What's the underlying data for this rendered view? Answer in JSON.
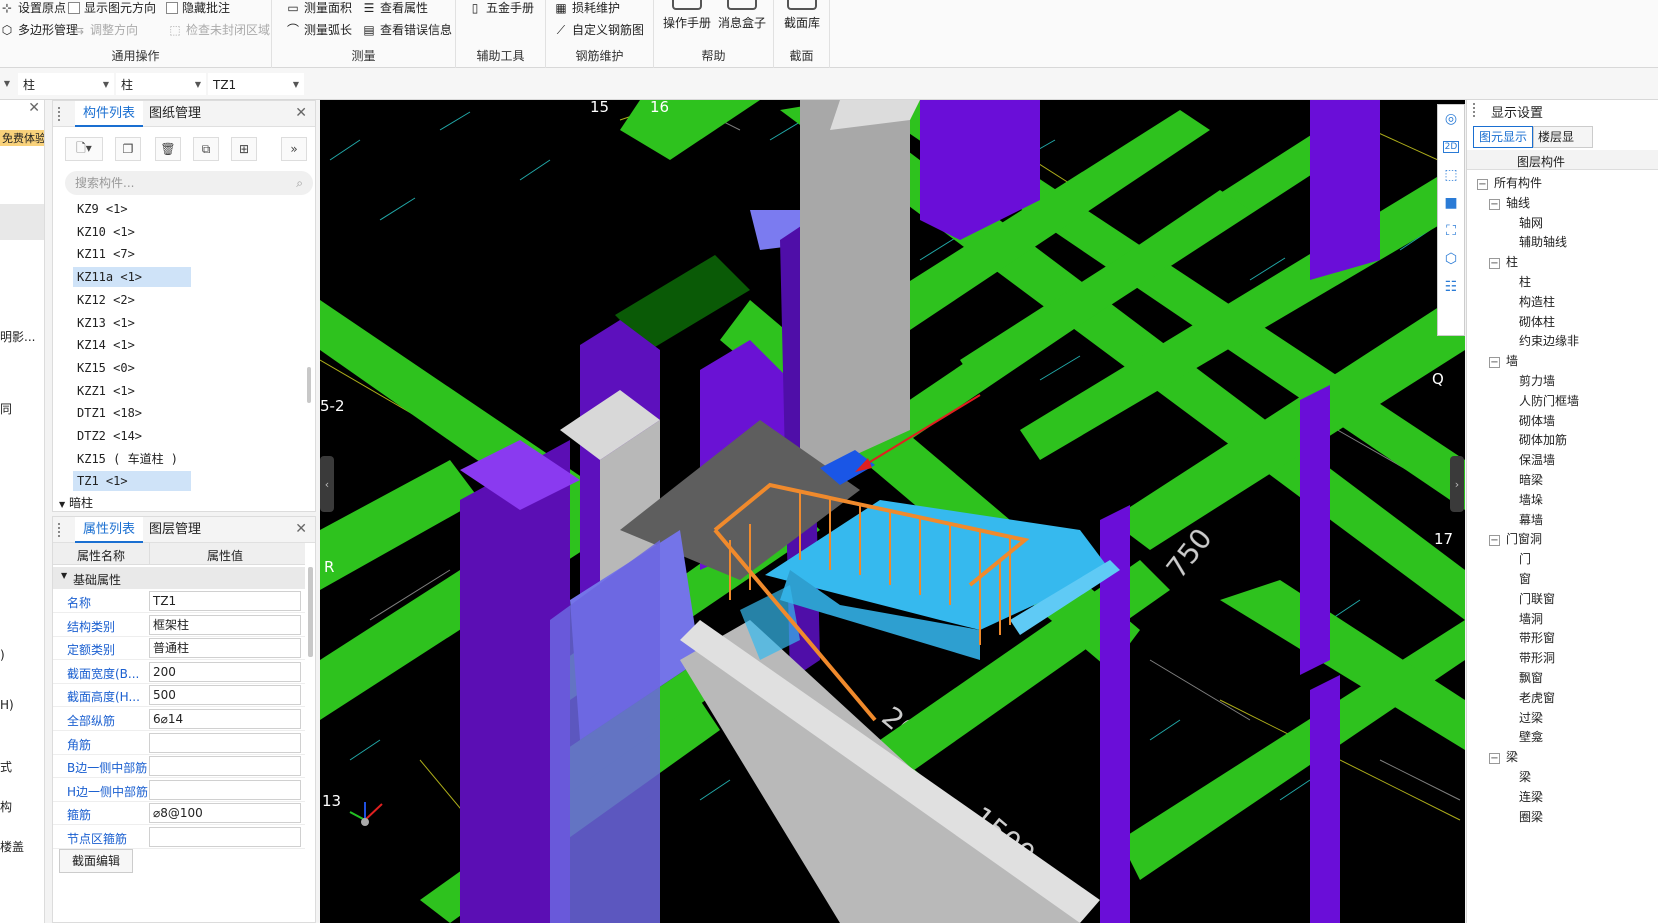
{
  "ribbon": {
    "groups": {
      "general": {
        "label": "通用操作",
        "items": [
          "设置原点",
          "显示图元方向",
          "隐藏批注",
          "多边形管理",
          "调整方向",
          "检查未封闭区域"
        ]
      },
      "measure": {
        "label": "测量",
        "items": [
          "测量面积",
          "查看属性",
          "测量弧长",
          "查看错误信息"
        ]
      },
      "aux": {
        "label": "辅助工具",
        "items": [
          "五金手册"
        ]
      },
      "rebar": {
        "label": "钢筋维护",
        "items": [
          "损耗维护",
          "自定义钢筋图"
        ]
      },
      "help": {
        "label": "帮助",
        "items": [
          "操作手册",
          "消息盒子"
        ]
      },
      "section": {
        "label": "截面",
        "items": [
          "截面库"
        ]
      }
    }
  },
  "selector": {
    "category": "柱",
    "type": "柱",
    "component": "TZ1"
  },
  "leftstrip": {
    "items": [
      "免费体验",
      "明影...",
      "同",
      ")",
      "H)",
      "式",
      "构",
      "楼盖"
    ]
  },
  "component_panel": {
    "tabs": [
      "构件列表",
      "图纸管理"
    ],
    "search_placeholder": "搜索构件...",
    "items": [
      {
        "label": "KZ9 <1>",
        "highlight": false
      },
      {
        "label": "KZ10 <1>",
        "highlight": false
      },
      {
        "label": "KZ11 <7>",
        "highlight": false
      },
      {
        "label": "KZ11a <1>",
        "highlight": true
      },
      {
        "label": "KZ12 <2>",
        "highlight": false
      },
      {
        "label": "KZ13 <1>",
        "highlight": false
      },
      {
        "label": "KZ14 <1>",
        "highlight": false
      },
      {
        "label": "KZ15 <0>",
        "highlight": false
      },
      {
        "label": "KZZ1 <1>",
        "highlight": false
      },
      {
        "label": "DTZ1 <18>",
        "highlight": false
      },
      {
        "label": "DTZ2 <14>",
        "highlight": false
      },
      {
        "label": "KZ15 ( 车道柱 ) <1>",
        "highlight": false
      },
      {
        "label": "TZ1 <1>",
        "highlight": true
      }
    ],
    "next_section": "暗柱"
  },
  "property_panel": {
    "tabs": [
      "属性列表",
      "图层管理"
    ],
    "col_name": "属性名称",
    "col_value": "属性值",
    "section": "基础属性",
    "rows": [
      {
        "name": "名称",
        "value": "TZ1"
      },
      {
        "name": "结构类别",
        "value": "框架柱"
      },
      {
        "name": "定额类别",
        "value": "普通柱"
      },
      {
        "name": "截面宽度(B...",
        "value": "200"
      },
      {
        "name": "截面高度(H...",
        "value": "500"
      },
      {
        "name": "全部纵筋",
        "value": "6⌀14"
      },
      {
        "name": "角筋",
        "value": ""
      },
      {
        "name": "B边一侧中部筋",
        "value": ""
      },
      {
        "name": "H边一侧中部筋",
        "value": ""
      },
      {
        "name": "箍筋",
        "value": "⌀8@100"
      },
      {
        "name": "节点区箍筋",
        "value": ""
      }
    ],
    "bottom_button": "截面编辑"
  },
  "viewport": {
    "labels": [
      "15",
      "16",
      "5-2",
      "R",
      "13",
      "Q",
      "17"
    ],
    "annotations": [
      "750",
      "200",
      "1500"
    ]
  },
  "display_panel": {
    "title": "显示设置",
    "tabs": [
      "图元显示",
      "楼层显"
    ],
    "header": "图层构件",
    "tree": [
      {
        "label": "所有构件",
        "level": 0,
        "group": true
      },
      {
        "label": "轴线",
        "level": 1,
        "group": true
      },
      {
        "label": "轴网",
        "level": 2,
        "group": false
      },
      {
        "label": "辅助轴线",
        "level": 2,
        "group": false
      },
      {
        "label": "柱",
        "level": 1,
        "group": true
      },
      {
        "label": "柱",
        "level": 2,
        "group": false
      },
      {
        "label": "构造柱",
        "level": 2,
        "group": false
      },
      {
        "label": "砌体柱",
        "level": 2,
        "group": false
      },
      {
        "label": "约束边缘非",
        "level": 2,
        "group": false
      },
      {
        "label": "墙",
        "level": 1,
        "group": true
      },
      {
        "label": "剪力墙",
        "level": 2,
        "group": false
      },
      {
        "label": "人防门框墙",
        "level": 2,
        "group": false
      },
      {
        "label": "砌体墙",
        "level": 2,
        "group": false
      },
      {
        "label": "砌体加筋",
        "level": 2,
        "group": false
      },
      {
        "label": "保温墙",
        "level": 2,
        "group": false
      },
      {
        "label": "暗梁",
        "level": 2,
        "group": false
      },
      {
        "label": "墙垛",
        "level": 2,
        "group": false
      },
      {
        "label": "幕墙",
        "level": 2,
        "group": false
      },
      {
        "label": "门窗洞",
        "level": 1,
        "group": true
      },
      {
        "label": "门",
        "level": 2,
        "group": false
      },
      {
        "label": "窗",
        "level": 2,
        "group": false
      },
      {
        "label": "门联窗",
        "level": 2,
        "group": false
      },
      {
        "label": "墙洞",
        "level": 2,
        "group": false
      },
      {
        "label": "带形窗",
        "level": 2,
        "group": false
      },
      {
        "label": "带形洞",
        "level": 2,
        "group": false
      },
      {
        "label": "飘窗",
        "level": 2,
        "group": false
      },
      {
        "label": "老虎窗",
        "level": 2,
        "group": false
      },
      {
        "label": "过梁",
        "level": 2,
        "group": false
      },
      {
        "label": "壁龛",
        "level": 2,
        "group": false
      },
      {
        "label": "梁",
        "level": 1,
        "group": true
      },
      {
        "label": "梁",
        "level": 2,
        "group": false
      },
      {
        "label": "连梁",
        "level": 2,
        "group": false
      },
      {
        "label": "圈梁",
        "level": 2,
        "group": false
      }
    ]
  },
  "colors": {
    "accent": "#1a6fd1",
    "beam_green": "#2ec21e",
    "column_purple": "#6a0ed8",
    "stair_blue": "#36b9ee",
    "rail_orange": "#f08a2c"
  }
}
